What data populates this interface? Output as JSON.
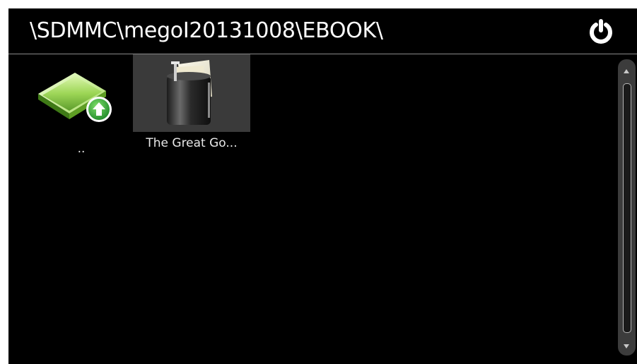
{
  "header": {
    "path": "\\SDMMC\\megoI20131008\\EBOOK\\",
    "power_icon": "power-icon"
  },
  "items": [
    {
      "label": "..",
      "icon": "folder-up-icon",
      "selected": false
    },
    {
      "label": "The Great Go...",
      "icon": "ebook-icon",
      "selected": true
    }
  ],
  "colors": {
    "background": "#000000",
    "selected_tile": "#3a3a3a",
    "folder_green": "#8fd14f",
    "up_badge": "#3cb043"
  }
}
